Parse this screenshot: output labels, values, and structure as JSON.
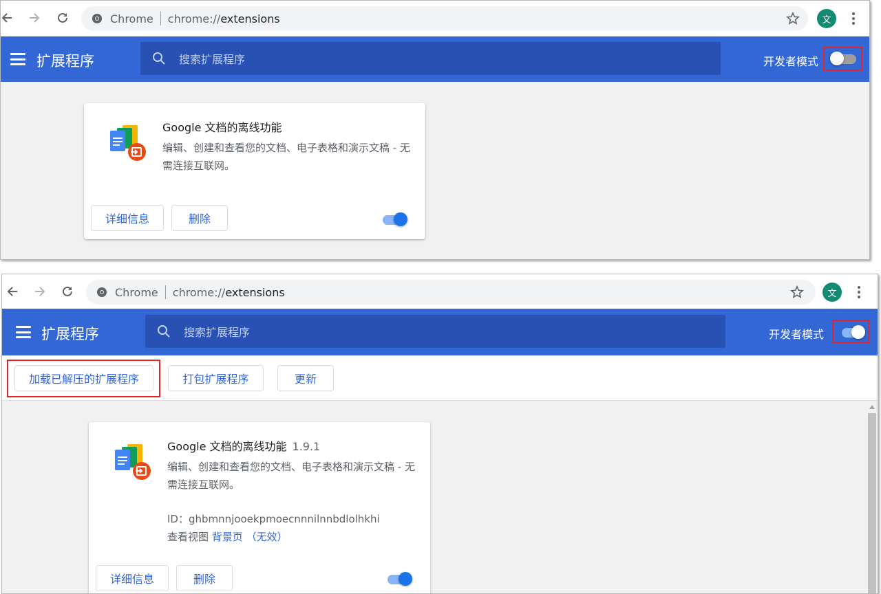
{
  "browser": {
    "site_chip": "Chrome",
    "url_scheme": "chrome://",
    "url_path": "extensions",
    "profile_initial": "文"
  },
  "header": {
    "title": "扩展程序",
    "search_placeholder": "搜索扩展程序",
    "dev_mode_label": "开发者模式"
  },
  "dev_toolbar": {
    "load_unpacked": "加载已解压的扩展程序",
    "pack_extension": "打包扩展程序",
    "update": "更新"
  },
  "screens": [
    {
      "dev_mode_on": false
    },
    {
      "dev_mode_on": true
    }
  ],
  "extension": {
    "name": "Google 文档的离线功能",
    "version": "1.9.1",
    "description": "编辑、创建和查看您的文档、电子表格和演示文稿 - 无需连接互联网。",
    "id_label": "ID：",
    "id_value": "ghbmnnjooekpmoecnnnilnnbdlolhkhi",
    "views_label": "查看视图",
    "views_link": "背景页",
    "views_status": "（无效）",
    "details_button": "详细信息",
    "remove_button": "删除",
    "enabled": true
  },
  "colors": {
    "header_blue": "#3367d6",
    "search_blue": "#2851b3",
    "link_blue": "#3367d6",
    "toggle_on": "#1a73e8",
    "highlight_red": "#e0262c"
  },
  "icons": [
    "back-arrow-icon",
    "forward-arrow-icon",
    "reload-icon",
    "chrome-site-icon",
    "star-icon",
    "kebab-menu-icon",
    "hamburger-icon",
    "search-icon",
    "google-docs-offline-icon"
  ]
}
